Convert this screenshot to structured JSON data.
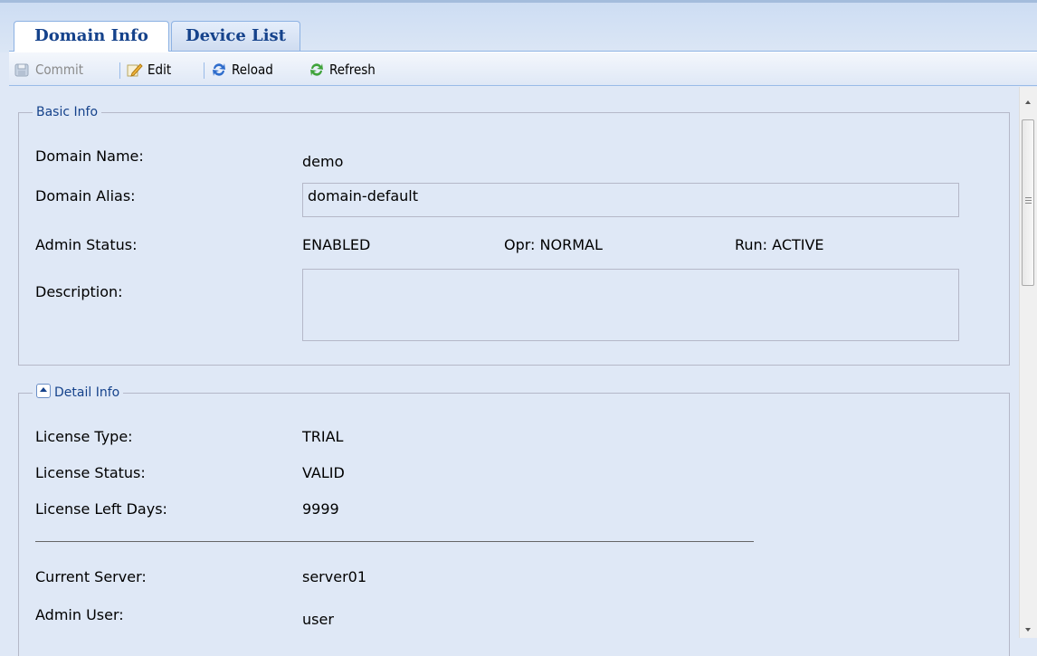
{
  "tabs": [
    {
      "label": "Domain Info",
      "active": true
    },
    {
      "label": "Device List",
      "active": false
    }
  ],
  "toolbar": {
    "commit_label": "Commit",
    "edit_label": "Edit",
    "reload_label": "Reload",
    "refresh_label": "Refresh"
  },
  "basic_info": {
    "legend": "Basic Info",
    "domain_name_label": "Domain Name:",
    "domain_name_value": "demo",
    "domain_alias_label": "Domain Alias:",
    "domain_alias_value": "domain-default",
    "admin_status_label": "Admin Status:",
    "admin_status_value": "ENABLED",
    "opr_status": "Opr: NORMAL",
    "run_status": "Run: ACTIVE",
    "description_label": "Description:",
    "description_value": ""
  },
  "detail_info": {
    "legend": "Detail Info",
    "license_type_label": "License Type:",
    "license_type_value": "TRIAL",
    "license_status_label": "License Status:",
    "license_status_value": "VALID",
    "license_days_label": "License Left Days:",
    "license_days_value": "9999",
    "current_server_label": "Current Server:",
    "current_server_value": "server01",
    "admin_user_label": "Admin User:",
    "admin_user_value": "user"
  },
  "colors": {
    "accent": "#15428b",
    "panel_bg": "#dfe8f6",
    "border": "#99bbe8"
  },
  "icons": {
    "commit": "save-icon",
    "edit": "pencil-icon",
    "reload": "reload-icon",
    "refresh": "refresh-icon",
    "collapse": "chevron-up-icon"
  }
}
